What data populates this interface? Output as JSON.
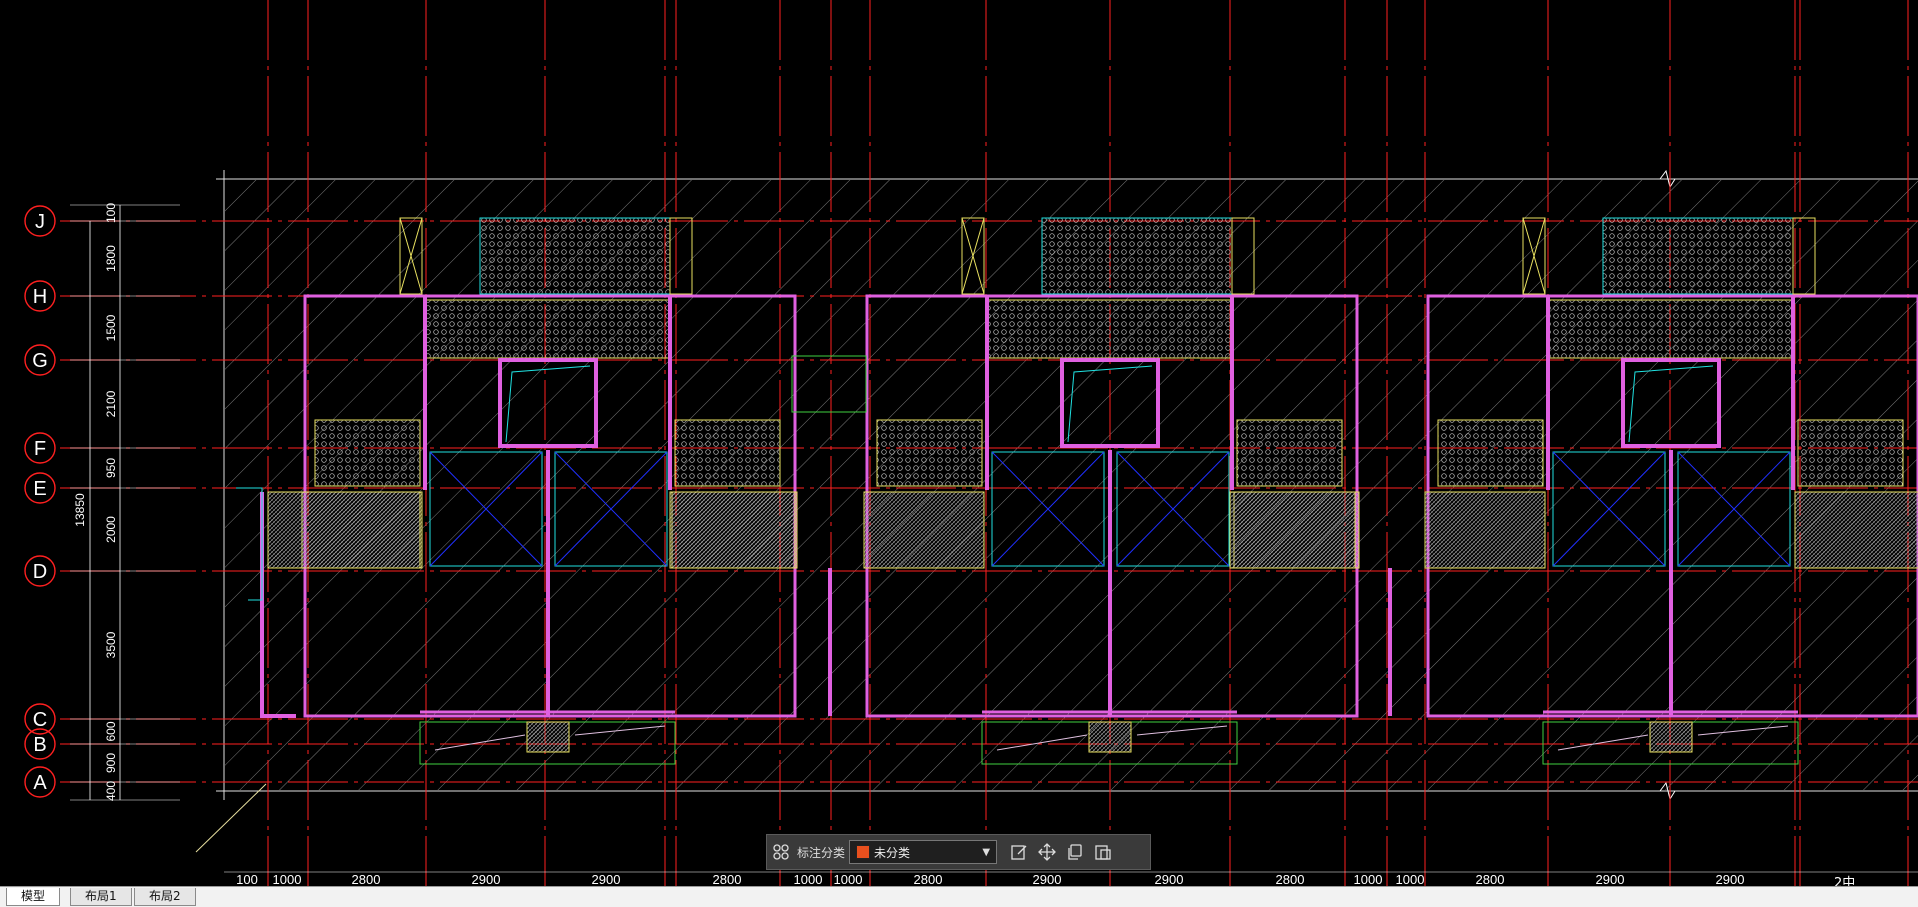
{
  "tabs": [
    {
      "label": "模型",
      "active": true
    },
    {
      "label": "布局1",
      "active": false
    },
    {
      "label": "布局2",
      "active": false
    }
  ],
  "toolbar": {
    "category_label": "标注分类",
    "category_value": "未分类",
    "category_color": "#e8501e",
    "icons": [
      "grid-icon",
      "edit-icon",
      "move-icon",
      "copy-icon",
      "paste-icon"
    ]
  },
  "axes_vertical": [
    {
      "label": "J"
    },
    {
      "label": "H"
    },
    {
      "label": "G"
    },
    {
      "label": "F"
    },
    {
      "label": "E"
    },
    {
      "label": "D"
    },
    {
      "label": "C"
    },
    {
      "label": "B"
    },
    {
      "label": "A"
    }
  ],
  "dims_left": [
    "100",
    "1800",
    "1500",
    "2100",
    "950",
    "2000",
    "3500",
    "600",
    "900",
    "400"
  ],
  "dim_total": "13850",
  "dims_bottom": [
    "100",
    "1000",
    "2800",
    "2900",
    "2900",
    "2800",
    "1000",
    "1000",
    "2800",
    "2900",
    "2900",
    "2800",
    "1000",
    "1000",
    "2800",
    "2900",
    "2900"
  ],
  "corner_text": "2中",
  "colors": {
    "background": "#000000",
    "axis_line": "#ff2020",
    "wall": "#e060e0",
    "hatch": "#c8c8c8",
    "cyan": "#20e0e0",
    "yellow": "#e8e060",
    "green": "#40d040",
    "blue": "#2030ff",
    "dimension": "#ffffff"
  }
}
